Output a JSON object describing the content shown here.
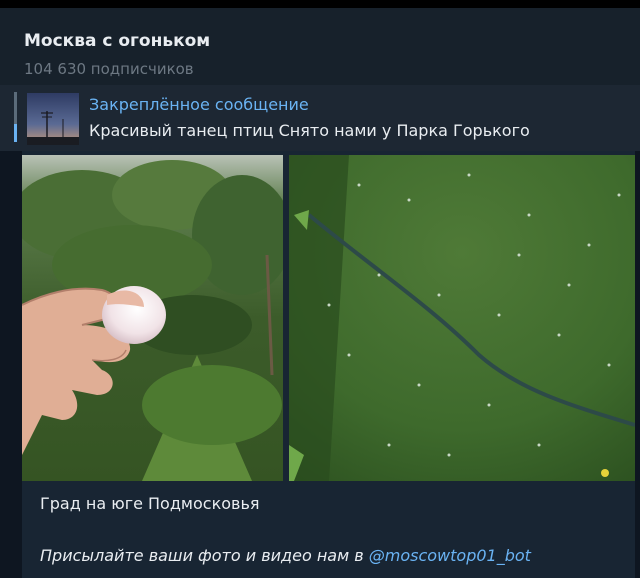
{
  "channel": {
    "title": "Москва с огоньком",
    "subscribers": "104 630 подписчиков"
  },
  "pinned": {
    "label": "Закреплённое сообщение",
    "text": "Красивый танец птиц  Снято нами у Парка Горького"
  },
  "message": {
    "photos": [
      "hand-holding-hailstone-photo",
      "hail-on-grass-photo"
    ],
    "caption": "Град на юге Подмосковья",
    "footer_prefix": "Присылайте ваши фото и видео нам в ",
    "footer_mention": "@moscowtop01_bot"
  },
  "colors": {
    "background": "#0e1621",
    "header": "#17212b",
    "bubble": "#182533",
    "accent": "#6ab3f3",
    "text": "#e9edf1",
    "muted": "#6d7883"
  }
}
